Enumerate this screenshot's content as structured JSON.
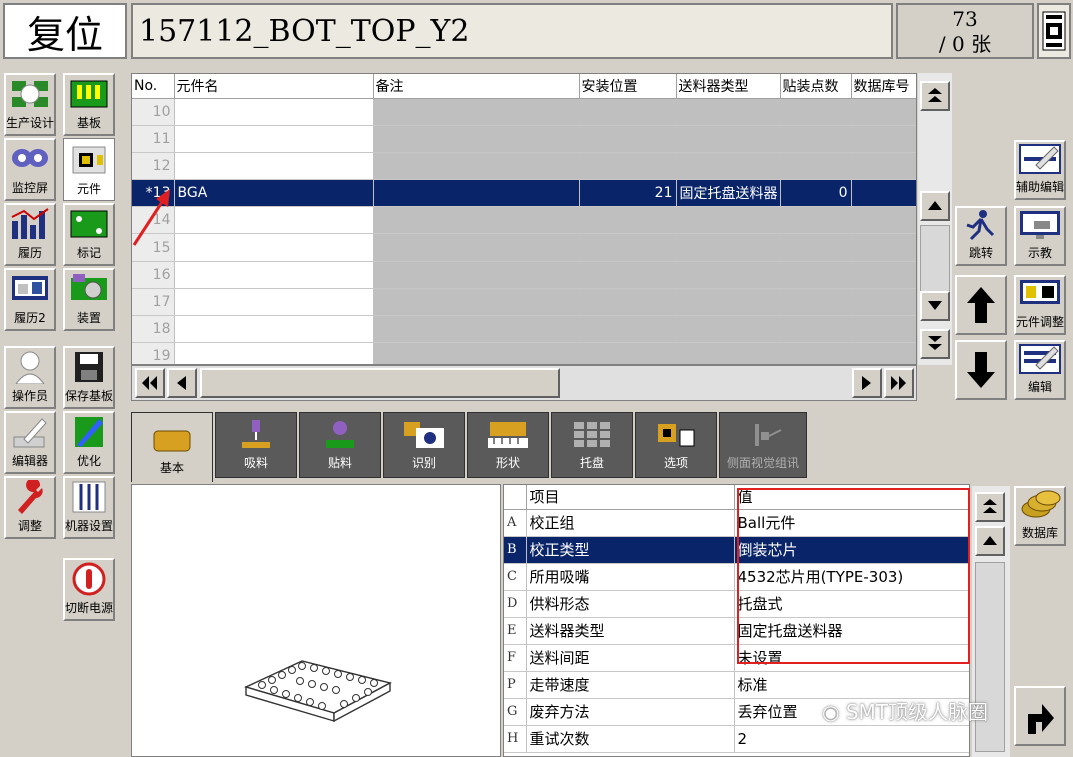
{
  "header": {
    "reset_label": "复位",
    "program_name": "157112_BOT_TOP_Y2",
    "count_top": "73",
    "count_bottom": "/ 0 张"
  },
  "nav": [
    {
      "label": "生产设计",
      "icon": "production-design-icon"
    },
    {
      "label": "基板",
      "icon": "board-icon"
    },
    {
      "label": "监控屏",
      "icon": "monitor-icon"
    },
    {
      "label": "元件",
      "icon": "component-icon"
    },
    {
      "label": "履历",
      "icon": "history-icon"
    },
    {
      "label": "标记",
      "icon": "mark-icon"
    },
    {
      "label": "履历2",
      "icon": "history2-icon"
    },
    {
      "label": "装置",
      "icon": "device-icon"
    },
    {
      "label": "操作员",
      "icon": "operator-icon"
    },
    {
      "label": "保存基板",
      "icon": "save-icon"
    },
    {
      "label": "编辑器",
      "icon": "editor-icon"
    },
    {
      "label": "优化",
      "icon": "optimize-icon"
    },
    {
      "label": "调整",
      "icon": "wrench-icon"
    },
    {
      "label": "机器设置",
      "icon": "machine-settings-icon"
    },
    {
      "label": "切断电源",
      "icon": "power-icon"
    }
  ],
  "grid": {
    "columns": [
      "No.",
      "元件名",
      "备注",
      "安装位置",
      "送料器类型",
      "贴装点数",
      "数据库号"
    ],
    "rows": [
      {
        "no": "10",
        "name": "",
        "note": "",
        "pos": "",
        "feeder": "",
        "points": "",
        "db": ""
      },
      {
        "no": "11",
        "name": "",
        "note": "",
        "pos": "",
        "feeder": "",
        "points": "",
        "db": ""
      },
      {
        "no": "12",
        "name": "",
        "note": "",
        "pos": "",
        "feeder": "",
        "points": "",
        "db": ""
      },
      {
        "no": "*13",
        "name": "BGA",
        "note": "",
        "pos": "21",
        "feeder": "固定托盘送料器",
        "points": "0",
        "db": ""
      },
      {
        "no": "14",
        "name": "",
        "note": "",
        "pos": "",
        "feeder": "",
        "points": "",
        "db": ""
      },
      {
        "no": "15",
        "name": "",
        "note": "",
        "pos": "",
        "feeder": "",
        "points": "",
        "db": ""
      },
      {
        "no": "16",
        "name": "",
        "note": "",
        "pos": "",
        "feeder": "",
        "points": "",
        "db": ""
      },
      {
        "no": "17",
        "name": "",
        "note": "",
        "pos": "",
        "feeder": "",
        "points": "",
        "db": ""
      },
      {
        "no": "18",
        "name": "",
        "note": "",
        "pos": "",
        "feeder": "",
        "points": "",
        "db": ""
      },
      {
        "no": "19",
        "name": "",
        "note": "",
        "pos": "",
        "feeder": "",
        "points": "",
        "db": ""
      }
    ]
  },
  "right_tools": {
    "aux_edit": "辅助编辑",
    "jump": "跳转",
    "teach": "示教",
    "comp_adjust": "元件调整",
    "edit": "编辑",
    "database": "数据库"
  },
  "tabs": [
    {
      "label": "基本",
      "icon": "basic-icon"
    },
    {
      "label": "吸料",
      "icon": "pickup-icon"
    },
    {
      "label": "贴料",
      "icon": "mount-icon"
    },
    {
      "label": "识别",
      "icon": "camera-icon"
    },
    {
      "label": "形状",
      "icon": "shape-icon"
    },
    {
      "label": "托盘",
      "icon": "tray-icon"
    },
    {
      "label": "选项",
      "icon": "option-icon"
    },
    {
      "label": "侧面视觉组讯",
      "icon": "side-vision-icon"
    }
  ],
  "props": {
    "col_item": "项目",
    "col_value": "值",
    "rows": [
      {
        "key": "A",
        "item": "校正组",
        "value": "Ball元件"
      },
      {
        "key": "B",
        "item": "校正类型",
        "value": "倒装芯片"
      },
      {
        "key": "C",
        "item": "所用吸嘴",
        "value": "4532芯片用(TYPE-303)"
      },
      {
        "key": "D",
        "item": "供料形态",
        "value": "托盘式"
      },
      {
        "key": "E",
        "item": "送料器类型",
        "value": "固定托盘送料器"
      },
      {
        "key": "F",
        "item": "送料间距",
        "value": "未设置"
      },
      {
        "key": "P",
        "item": "走带速度",
        "value": "标准"
      },
      {
        "key": "G",
        "item": "废弃方法",
        "value": "丢弃位置"
      },
      {
        "key": "H",
        "item": "重试次数",
        "value": "2"
      }
    ]
  },
  "watermark": "SMT顶级人脉圈",
  "colors": {
    "selection": "#0a246a",
    "annotation": "#e02020",
    "tab_dark": "#5a5a5a"
  }
}
